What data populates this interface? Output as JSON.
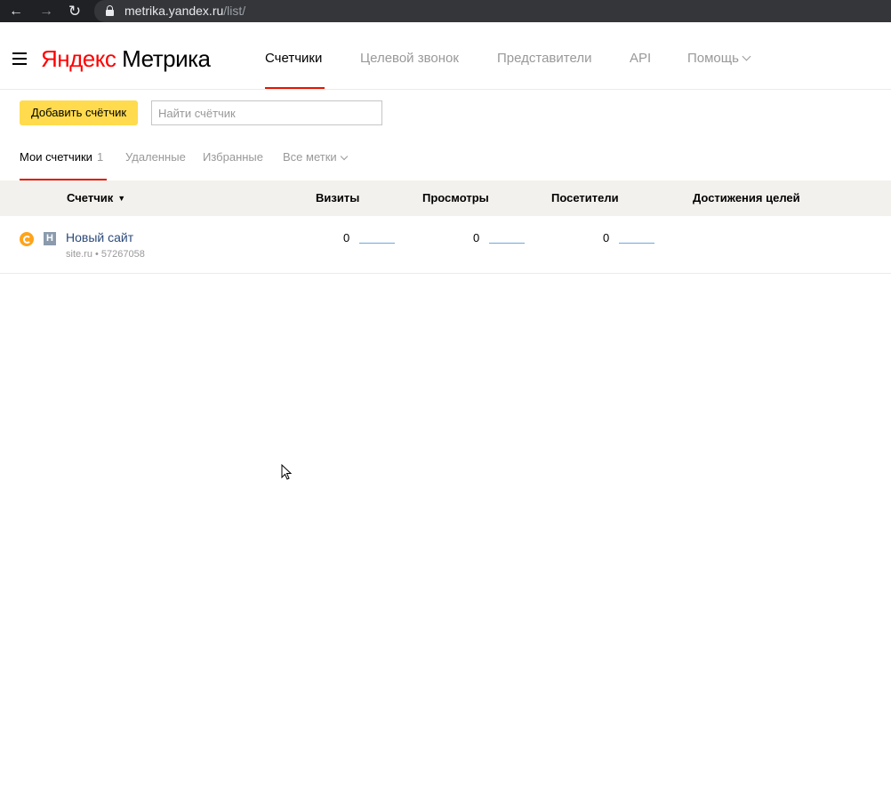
{
  "browser": {
    "url_host": "metrika.yandex.ru",
    "url_path": "/list/"
  },
  "header": {
    "logo_ya": "Яндекс",
    "logo_rest": " Метрика",
    "tabs": [
      {
        "label": "Счетчики",
        "active": true
      },
      {
        "label": "Целевой звонок",
        "active": false
      },
      {
        "label": "Представители",
        "active": false
      },
      {
        "label": "API",
        "active": false
      },
      {
        "label": "Помощь",
        "active": false
      }
    ]
  },
  "toolbar": {
    "add_label": "Добавить счётчик",
    "search_placeholder": "Найти счётчик"
  },
  "subtabs": {
    "mine_label": "Мои счетчики",
    "mine_count": "1",
    "deleted_label": "Удаленные",
    "favorites_label": "Избранные",
    "tags_label": "Все метки"
  },
  "table": {
    "headers": {
      "counter": "Счетчик",
      "sort_mark": "▼",
      "visits": "Визиты",
      "views": "Просмотры",
      "visitors": "Посетители",
      "goals": "Достижения целей"
    },
    "rows": [
      {
        "type_letter": "Н",
        "name": "Новый сайт",
        "meta": "site.ru • 57267058",
        "visits": "0",
        "views": "0",
        "visitors": "0"
      }
    ]
  },
  "colors": {
    "accent_red": "#e61400",
    "button_yellow": "#ffdb4d",
    "status_orange": "#ffa31a"
  }
}
